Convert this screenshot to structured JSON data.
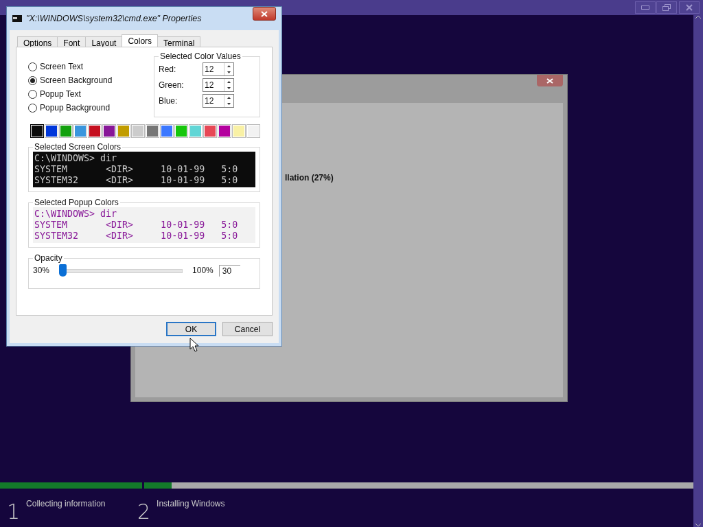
{
  "setup_dialog": {
    "status": "llation (27%)"
  },
  "properties_dialog": {
    "title": "\"X:\\WINDOWS\\system32\\cmd.exe\" Properties",
    "tabs": [
      {
        "label": "Options",
        "selected": false
      },
      {
        "label": "Font",
        "selected": false
      },
      {
        "label": "Layout",
        "selected": false
      },
      {
        "label": "Colors",
        "selected": true
      },
      {
        "label": "Terminal",
        "selected": false
      }
    ],
    "color_targets": [
      {
        "label": "Screen Text",
        "selected": false
      },
      {
        "label": "Screen Background",
        "selected": true
      },
      {
        "label": "Popup Text",
        "selected": false
      },
      {
        "label": "Popup Background",
        "selected": false
      }
    ],
    "color_values": {
      "title": "Selected Color Values",
      "fields": [
        {
          "label": "Red:",
          "value": "12"
        },
        {
          "label": "Green:",
          "value": "12"
        },
        {
          "label": "Blue:",
          "value": "12"
        }
      ]
    },
    "palette": [
      {
        "color": "#0c0c0c",
        "selected": true
      },
      {
        "color": "#0037da",
        "selected": false
      },
      {
        "color": "#13a10e",
        "selected": false
      },
      {
        "color": "#3a96dd",
        "selected": false
      },
      {
        "color": "#c50f1f",
        "selected": false
      },
      {
        "color": "#881798",
        "selected": false
      },
      {
        "color": "#c19c00",
        "selected": false
      },
      {
        "color": "#cccccc",
        "selected": false
      },
      {
        "color": "#767676",
        "selected": false
      },
      {
        "color": "#3b78ff",
        "selected": false
      },
      {
        "color": "#16c60c",
        "selected": false
      },
      {
        "color": "#61d6d6",
        "selected": false
      },
      {
        "color": "#e74856",
        "selected": false
      },
      {
        "color": "#b4009e",
        "selected": false
      },
      {
        "color": "#f9f1a5",
        "selected": false
      },
      {
        "color": "#f2f2f2",
        "selected": false
      }
    ],
    "screen_colors": {
      "title": "Selected Screen Colors",
      "lines": [
        "C:\\WINDOWS> dir",
        "SYSTEM       <DIR>     10-01-99   5:0",
        "SYSTEM32     <DIR>     10-01-99   5:0"
      ]
    },
    "popup_colors": {
      "title": "Selected Popup Colors",
      "lines": [
        "C:\\WINDOWS> dir",
        "SYSTEM       <DIR>     10-01-99   5:0",
        "SYSTEM32     <DIR>     10-01-99   5:0"
      ]
    },
    "opacity": {
      "title": "Opacity",
      "min_label": "30%",
      "max_label": "100%",
      "level": 0,
      "value": "30"
    },
    "buttons": [
      {
        "label": "OK",
        "default": true
      },
      {
        "label": "Cancel",
        "default": false
      }
    ]
  },
  "progress": {
    "steps": [
      {
        "number": "1",
        "label": "Collecting information",
        "level": 1
      },
      {
        "number": "2",
        "label": "Installing Windows",
        "level": 0.05
      }
    ]
  }
}
